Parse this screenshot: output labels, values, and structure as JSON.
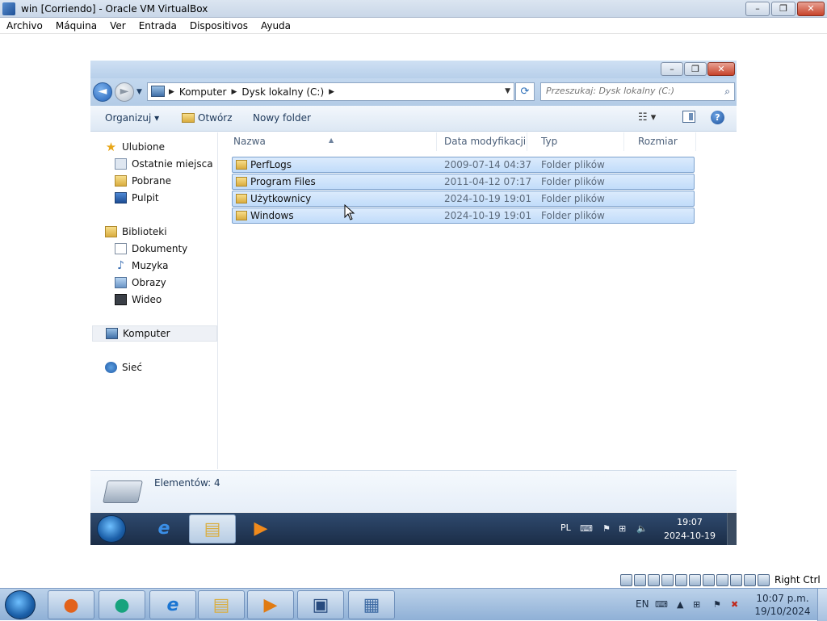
{
  "host": {
    "title": "win [Corriendo] - Oracle VM VirtualBox",
    "controls": {
      "minimize": "–",
      "restore": "❐",
      "close": "✕"
    },
    "menu": [
      "Archivo",
      "Máquina",
      "Ver",
      "Entrada",
      "Dispositivos",
      "Ayuda"
    ],
    "status_label": "Right Ctrl",
    "taskbar": {
      "apps": [
        {
          "name": "firefox",
          "glyph": "●",
          "color": "#e2621b"
        },
        {
          "name": "vpn-app",
          "glyph": "●",
          "color": "#17a37d"
        },
        {
          "name": "internet-explorer",
          "glyph": "e",
          "color": "#1a75d2"
        },
        {
          "name": "file-explorer",
          "glyph": "▤",
          "color": "#d9ad3f"
        },
        {
          "name": "media-player",
          "glyph": "▶",
          "color": "#e07b12"
        },
        {
          "name": "virtualbox",
          "glyph": "▣",
          "color": "#274a7e"
        },
        {
          "name": "vm-window",
          "glyph": "▦",
          "color": "#3d6aa3"
        }
      ],
      "lang": "EN",
      "time": "10:07 p.m.",
      "date": "19/10/2024"
    }
  },
  "explorer": {
    "controls": {
      "minimize": "–",
      "restore": "❐",
      "close": "✕"
    },
    "nav": {
      "back": "◄",
      "forward": "►",
      "dropdown": "▼"
    },
    "breadcrumbs": [
      "Komputer",
      "Dysk lokalny (C:)"
    ],
    "crumb_separator": "▶",
    "address_dropdown": "▼",
    "refresh": "⟳",
    "search_placeholder": "Przeszukaj: Dysk lokalny (C:)",
    "search_glyph": "⌕",
    "toolbar": {
      "organize": "Organizuj ▾",
      "open": "Otwórz",
      "new_folder": "Nowy folder",
      "view_glyph": "☷ ▾",
      "help_glyph": "?"
    },
    "nav_pane": {
      "favorites_header": "Ulubione",
      "favorites": [
        "Ostatnie miejsca",
        "Pobrane",
        "Pulpit"
      ],
      "libraries_header": "Biblioteki",
      "libraries": [
        "Dokumenty",
        "Muzyka",
        "Obrazy",
        "Wideo"
      ],
      "computer": "Komputer",
      "network": "Sieć",
      "star_glyph": "★",
      "music_glyph": "♪"
    },
    "columns": [
      "Nazwa",
      "Data modyfikacji",
      "Typ",
      "Rozmiar"
    ],
    "sort_caret": "▲",
    "files": [
      {
        "name": "PerfLogs",
        "date": "2009-07-14 04:37",
        "type": "Folder plików"
      },
      {
        "name": "Program Files",
        "date": "2011-04-12 07:17",
        "type": "Folder plików"
      },
      {
        "name": "Użytkownicy",
        "date": "2024-10-19 19:01",
        "type": "Folder plików"
      },
      {
        "name": "Windows",
        "date": "2024-10-19 19:01",
        "type": "Folder plików"
      }
    ],
    "details": {
      "count": "Elementów: 4"
    }
  },
  "guest_taskbar": {
    "apps": [
      {
        "name": "internet-explorer",
        "glyph": "e",
        "color": "#1a75d2",
        "active": false
      },
      {
        "name": "file-explorer",
        "glyph": "▤",
        "color": "#d9ad3f",
        "active": true
      },
      {
        "name": "media-player",
        "glyph": "▶",
        "color": "#e07b12",
        "active": false
      }
    ],
    "lang": "PL",
    "time": "19:07",
    "date": "2024-10-19"
  },
  "colors": {
    "selection": "#c1dcfa",
    "selection_border": "#7da2ce",
    "link_text": "#1e395b"
  }
}
